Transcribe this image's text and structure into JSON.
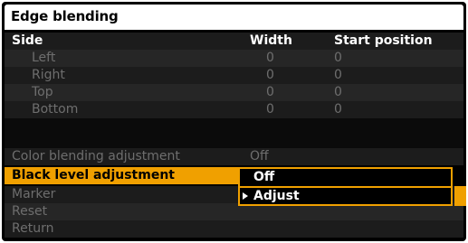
{
  "menu": {
    "title": "Edge blending",
    "columns": {
      "side": "Side",
      "width": "Width",
      "start_position": "Start position"
    },
    "sides": [
      {
        "label": "Left",
        "width": "0",
        "start": "0"
      },
      {
        "label": "Right",
        "width": "0",
        "start": "0"
      },
      {
        "label": "Top",
        "width": "0",
        "start": "0"
      },
      {
        "label": "Bottom",
        "width": "0",
        "start": "0"
      }
    ],
    "color_blending": {
      "label": "Color blending adjustment",
      "value": "Off"
    },
    "black_level": {
      "label": "Black level adjustment"
    },
    "marker": {
      "label": "Marker"
    },
    "reset": {
      "label": "Reset"
    },
    "return": {
      "label": "Return"
    }
  },
  "popup": {
    "options": [
      "Off",
      "Adjust"
    ],
    "highlighted": "Adjust"
  },
  "colors": {
    "accent": "#f0a000",
    "panel": "#000000",
    "disabled_text": "#6e6e6e"
  },
  "icons": [
    "right-triangle-icon"
  ]
}
